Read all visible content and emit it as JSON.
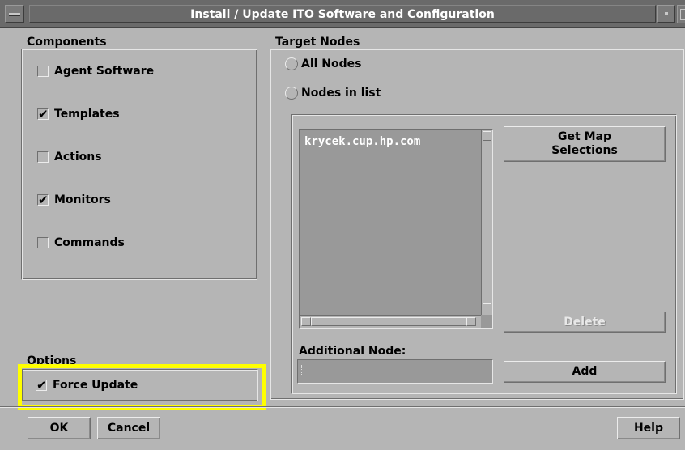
{
  "window": {
    "title": "Install / Update ITO Software and Configuration"
  },
  "components": {
    "label": "Components",
    "items": [
      {
        "label": "Agent Software",
        "checked": false
      },
      {
        "label": "Templates",
        "checked": true
      },
      {
        "label": "Actions",
        "checked": false
      },
      {
        "label": "Monitors",
        "checked": true
      },
      {
        "label": "Commands",
        "checked": false
      }
    ]
  },
  "options": {
    "label": "Options",
    "force_update": {
      "label": "Force Update",
      "checked": true
    }
  },
  "target_nodes": {
    "label": "Target Nodes",
    "radio_all": "All Nodes",
    "radio_list": "Nodes in list",
    "nodes": [
      "krycek.cup.hp.com"
    ],
    "get_map_label": "Get Map\nSelections",
    "get_map_line1": "Get Map",
    "get_map_line2": "Selections",
    "delete_label": "Delete",
    "add_label": "Add",
    "additional_node_label": "Additional Node:",
    "additional_node_value": ""
  },
  "footer": {
    "ok_label": "OK",
    "cancel_label": "Cancel",
    "help_label": "Help"
  },
  "colors": {
    "background": "#b5b5b5",
    "titlebar": "#6a6a6a",
    "list_bg": "#999999",
    "highlight": "#ffff00"
  }
}
